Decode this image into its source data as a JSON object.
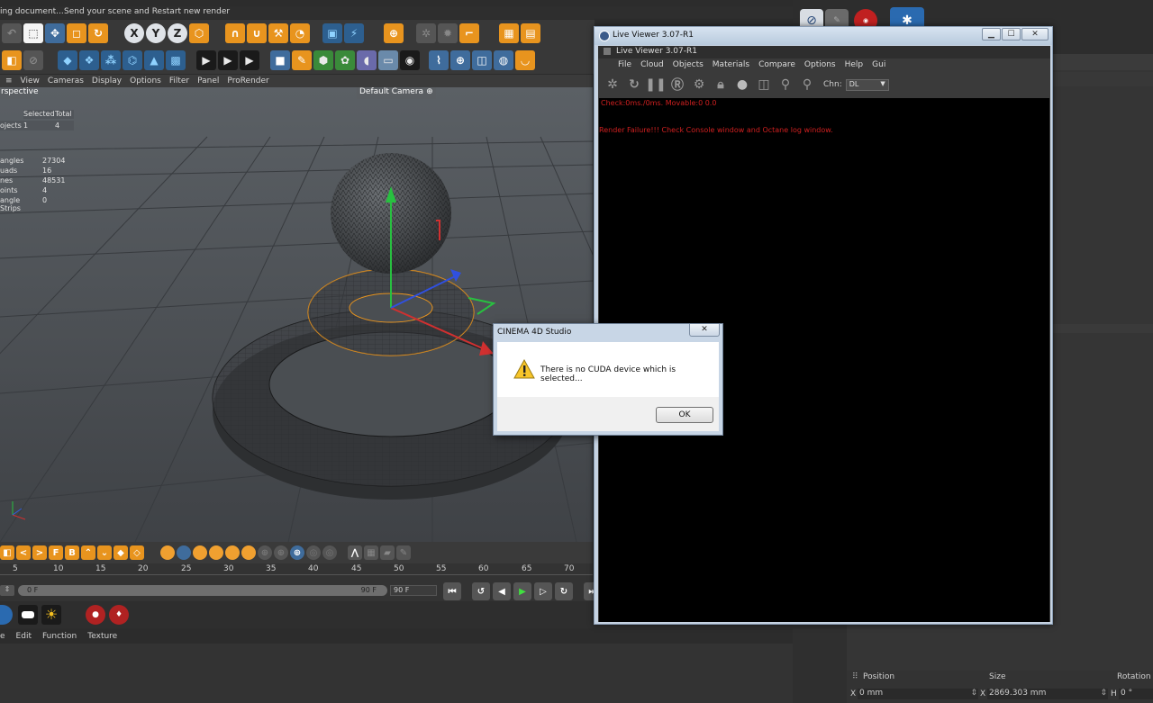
{
  "status": {
    "left_text": "ing document...",
    "right_text": "Send your scene and Restart new render"
  },
  "viewport": {
    "menu": [
      "View",
      "Cameras",
      "Display",
      "Options",
      "Filter",
      "Panel",
      "ProRender"
    ],
    "menu_first_glyph": "≡",
    "name": "rspective",
    "camera": "Default Camera",
    "camera_icon": "⊕",
    "hud": {
      "header_selected": "Selected",
      "header_total": "Total",
      "objects_label": "ojects",
      "objects_selected": "1",
      "objects_total": "4",
      "rows": [
        {
          "label": "angles",
          "value": "27304"
        },
        {
          "label": "uads",
          "value": "16"
        },
        {
          "label": "nes",
          "value": "48531"
        },
        {
          "label": "oints",
          "value": "4"
        },
        {
          "label": "angle Strips",
          "value": "0"
        }
      ]
    }
  },
  "timeline": {
    "ruler_ticks": [
      "5",
      "10",
      "15",
      "20",
      "25",
      "30",
      "35",
      "40",
      "45",
      "50",
      "55",
      "60",
      "65",
      "70"
    ],
    "start_field": "0 F",
    "end_field": "90 F",
    "end_value": "90 F"
  },
  "material_menu": {
    "items": [
      "e",
      "Edit",
      "Function",
      "Texture"
    ]
  },
  "coordinates": {
    "headers": [
      "Position",
      "Size",
      "Rotation"
    ],
    "x_label": "X",
    "position_x": "0 mm",
    "size_x_label": "X",
    "size_x": "2869.303 mm",
    "rot_label": "H",
    "rotation_h": "0 °"
  },
  "live_viewer": {
    "window_title": "Live Viewer 3.07-R1",
    "inner_title": "Live Viewer 3.07-R1",
    "menu": [
      "File",
      "Cloud",
      "Objects",
      "Materials",
      "Compare",
      "Options",
      "Help",
      "Gui"
    ],
    "channel_label": "Chn:",
    "channel_value": "DL",
    "status_line": "Check:0ms./0ms. Movable:0  0.0",
    "error_line": "Render Failure!!! Check Console window and Octane log window.",
    "text_color": "#d02020"
  },
  "dialog": {
    "title": "CINEMA 4D Studio",
    "message": "There is no CUDA device which is selected...",
    "ok_label": "OK",
    "close_glyph": "✕"
  },
  "colors": {
    "accent": "#e8941e",
    "viewport_bg": "#4a4e52",
    "dialog_frame": "#c8d6e6"
  }
}
